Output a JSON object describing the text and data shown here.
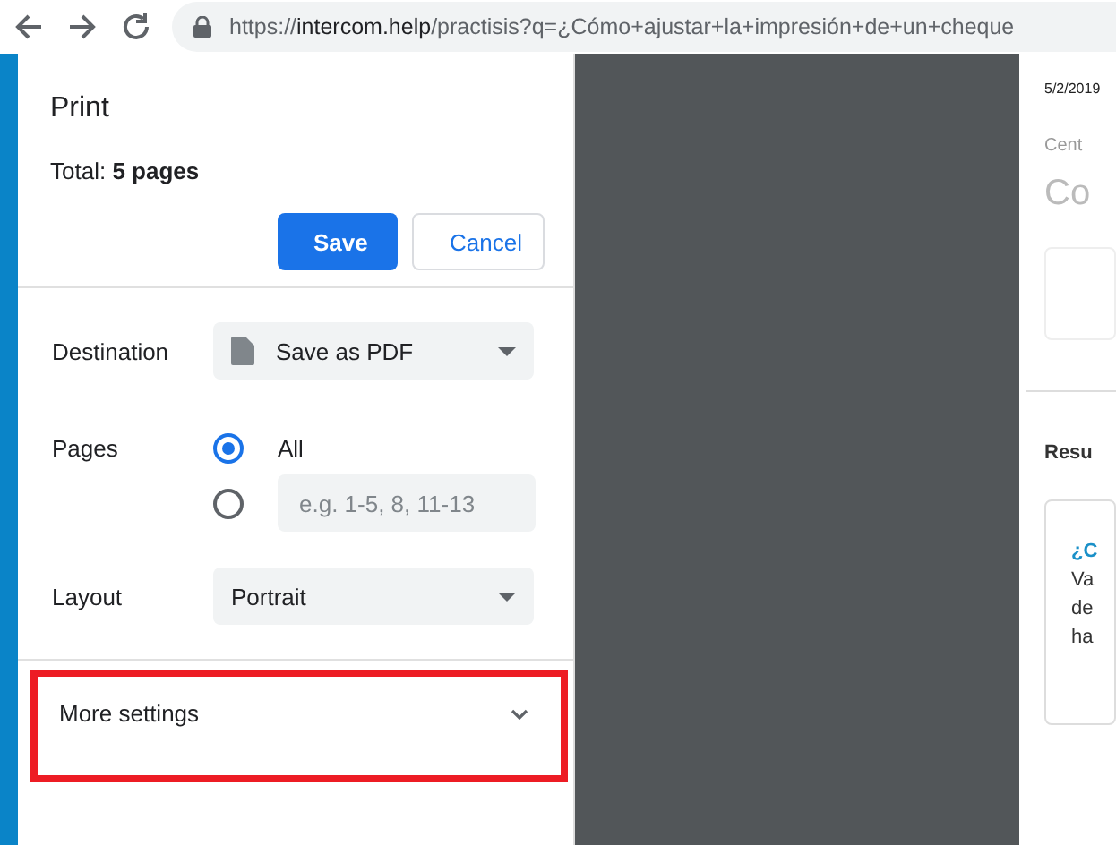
{
  "browser": {
    "url_parts": [
      {
        "text": "https://",
        "kind": "dim"
      },
      {
        "text": "intercom.help",
        "kind": "host"
      },
      {
        "text": "/practisis?q=¿Cómo+ajustar+la+impresión+de+un+cheque",
        "kind": "dim"
      }
    ]
  },
  "print_dialog": {
    "title": "Print",
    "total_label": "Total: ",
    "total_value": "5 pages",
    "buttons": [
      {
        "label": "Save",
        "kind": "primary"
      },
      {
        "label": "Cancel",
        "kind": "secondary"
      }
    ],
    "destination": {
      "label": "Destination",
      "value": "Save as PDF"
    },
    "pages": {
      "label": "Pages",
      "options": [
        {
          "kind": "text",
          "text": "All",
          "selected": true
        },
        {
          "kind": "input",
          "placeholder": "e.g. 1-5, 8, 11-13",
          "selected": false
        }
      ]
    },
    "layout": {
      "label": "Layout",
      "value": "Portrait"
    },
    "more_settings": {
      "label": "More settings",
      "expanded": false,
      "highlighted": true
    }
  },
  "preview": {
    "date": "5/2/2019",
    "crumb": "Cent",
    "heading": "Co",
    "section": "Resu",
    "card_title": "¿C",
    "card_lines": [
      "Va",
      "de",
      "ha"
    ]
  }
}
